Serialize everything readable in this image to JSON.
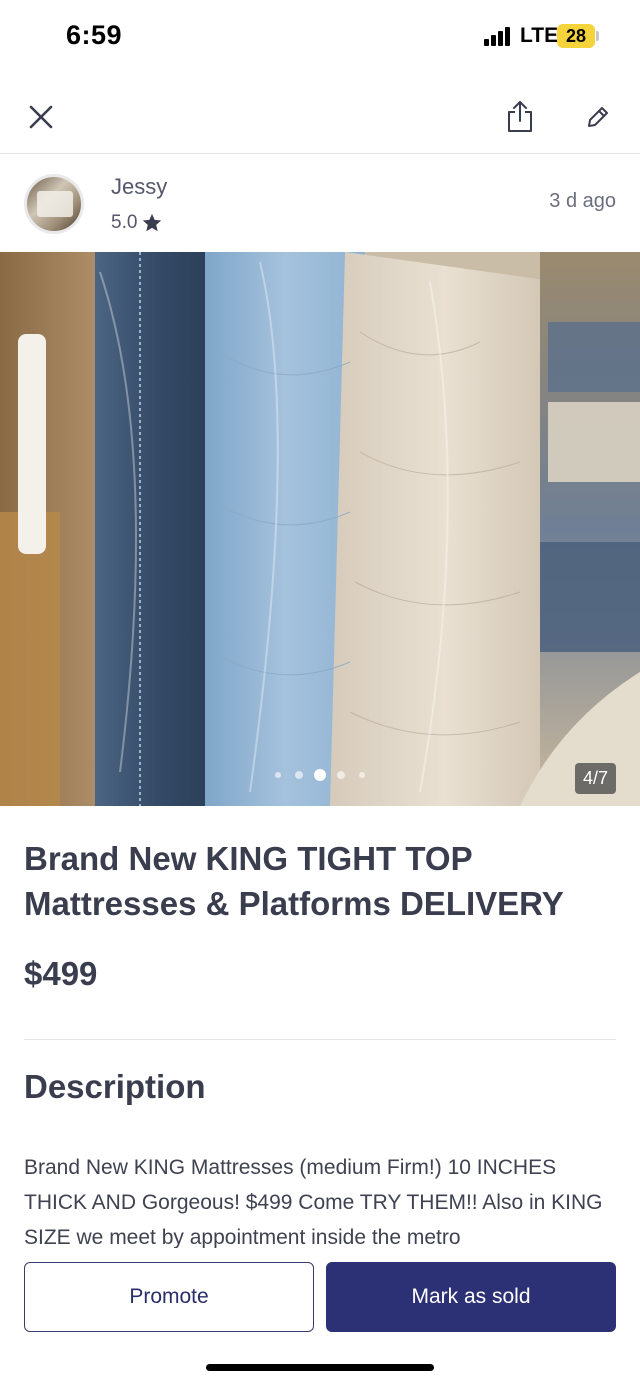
{
  "status_bar": {
    "time": "6:59",
    "network": "LTE",
    "battery": "28",
    "battery_color": "#f5d33a"
  },
  "nav": {
    "close_icon": "close-icon",
    "share_icon": "share-icon",
    "edit_icon": "pencil-icon"
  },
  "seller": {
    "name": "Jessy",
    "rating": "5.0",
    "posted": "3 d  ago"
  },
  "photo": {
    "counter": "4/7",
    "current_index": 4,
    "total": 7
  },
  "listing": {
    "title": "Brand New KING TIGHT TOP Mattresses & Platforms DELIVERY",
    "price": "$499"
  },
  "description": {
    "heading": "Description",
    "body": "Brand New KING Mattresses (medium Firm!) 10 INCHES THICK AND Gorgeous! $499 Come TRY THEM!! Also in KING SIZE we meet by appointment inside the metro"
  },
  "actions": {
    "promote_label": "Promote",
    "mark_sold_label": "Mark as sold"
  },
  "colors": {
    "primary": "#2c3176",
    "text": "#3a3d4e"
  }
}
